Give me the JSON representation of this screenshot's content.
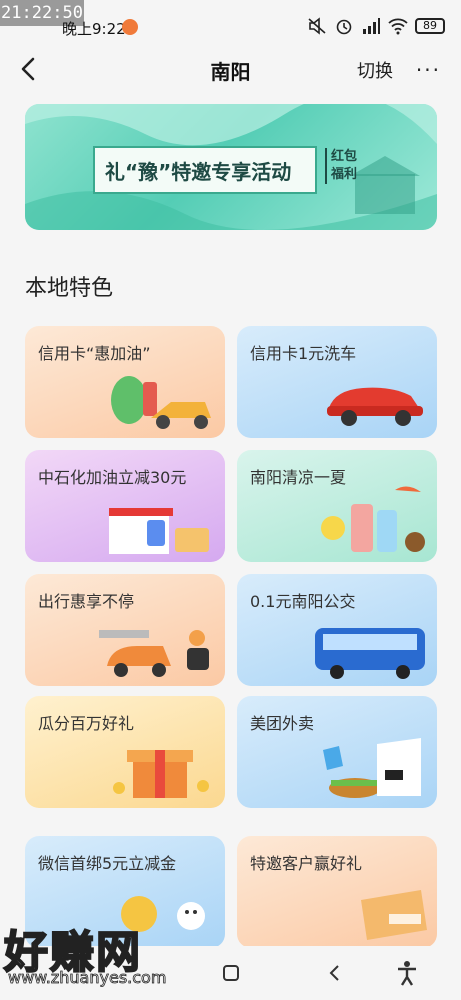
{
  "status": {
    "badge_time": "21:22:50",
    "system_time": "晚上9:22",
    "battery": "89",
    "icons": [
      "mute-icon",
      "alarm-icon",
      "signal-icon",
      "wifi-icon",
      "battery-icon"
    ]
  },
  "nav": {
    "title": "南阳",
    "switch_label": "切换",
    "more_label": "···"
  },
  "banner": {
    "text": "礼“豫”特邀专享活动",
    "tag": "红包福利",
    "accent": "#54cdb5"
  },
  "section": {
    "title": "本地特色"
  },
  "cards": [
    {
      "label": "信用卡“惠加油”",
      "icon": "gas-car-icon"
    },
    {
      "label": "信用卡1元洗车",
      "icon": "red-car-icon"
    },
    {
      "label": "中石化加油立减30元",
      "icon": "gas-station-icon"
    },
    {
      "label": "南阳清凉一夏",
      "icon": "drinks-icon"
    },
    {
      "label": "出行惠享不停",
      "icon": "scooter-icon"
    },
    {
      "label": "0.1元南阳公交",
      "icon": "bus-icon"
    },
    {
      "label": "瓜分百万好礼",
      "icon": "gift-box-icon"
    },
    {
      "label": "美团外卖",
      "icon": "takeout-bag-icon"
    },
    {
      "label": "微信首绑5元立减金",
      "icon": "wechat-gift-icon"
    },
    {
      "label": "特邀客户赢好礼",
      "icon": "present-icon"
    }
  ],
  "watermark": {
    "line1": "好赚网",
    "line2": "www.zhuanyes.com"
  }
}
